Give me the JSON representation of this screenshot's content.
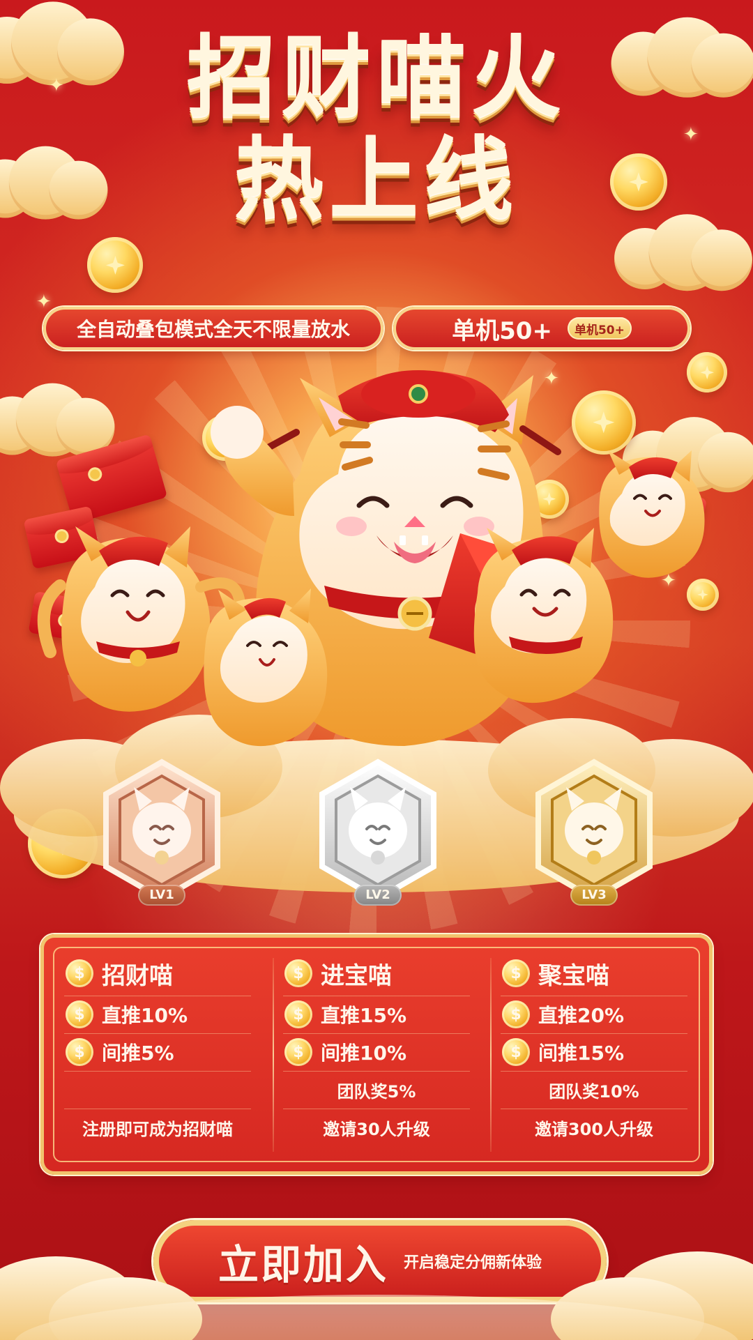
{
  "hero": {
    "title_line1": "招财喵火",
    "title_line2": "热上线"
  },
  "banners": {
    "left": "全自动叠包模式全天不限量放水",
    "right": "单机50+",
    "right_badge": "单机50+"
  },
  "badges": [
    {
      "level": "LV1"
    },
    {
      "level": "LV2"
    },
    {
      "level": "LV3"
    }
  ],
  "tiers": [
    {
      "name": "招财喵",
      "direct": "直推10%",
      "indirect": "间推5%",
      "team": "",
      "requirement": "注册即可成为招财喵"
    },
    {
      "name": "进宝喵",
      "direct": "直推15%",
      "indirect": "间推10%",
      "team": "团队奖5%",
      "requirement": "邀请30人升级"
    },
    {
      "name": "聚宝喵",
      "direct": "直推20%",
      "indirect": "间推15%",
      "team": "团队奖10%",
      "requirement": "邀请300人升级"
    }
  ],
  "cta": {
    "label": "立即加入",
    "subtext": "开启稳定分佣新体验"
  },
  "icons": {
    "currency": "dollar-coin-icon",
    "coin": "gold-coin-icon"
  },
  "colors": {
    "primary_red": "#d22a22",
    "deep_red": "#ab1015",
    "gold": "#f4d27f",
    "text_light": "#fff6df"
  }
}
